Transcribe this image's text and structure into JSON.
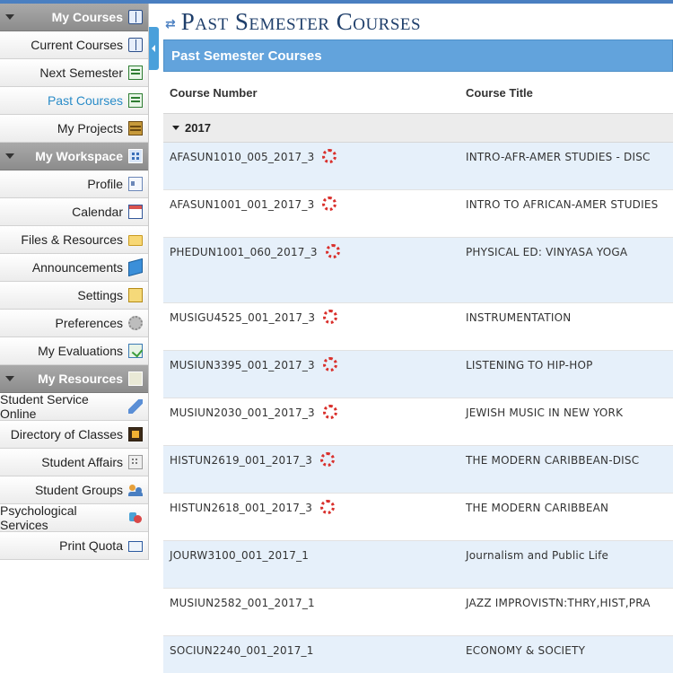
{
  "sidebar": {
    "sections": [
      {
        "title": "My Courses",
        "icon": "course-book-icon",
        "items": [
          {
            "label": "Current Courses",
            "icon": "open-book-icon",
            "active": false
          },
          {
            "label": "Next Semester",
            "icon": "next-semester-icon",
            "active": false
          },
          {
            "label": "Past Courses",
            "icon": "past-courses-icon",
            "active": true
          },
          {
            "label": "My Projects",
            "icon": "projects-icon",
            "active": false
          }
        ]
      },
      {
        "title": "My Workspace",
        "icon": "workspace-grid-icon",
        "items": [
          {
            "label": "Profile",
            "icon": "profile-card-icon"
          },
          {
            "label": "Calendar",
            "icon": "calendar-icon"
          },
          {
            "label": "Files & Resources",
            "icon": "folder-icon"
          },
          {
            "label": "Announcements",
            "icon": "megaphone-icon"
          },
          {
            "label": "Settings",
            "icon": "settings-icon"
          },
          {
            "label": "Preferences",
            "icon": "gear-icon"
          },
          {
            "label": "My Evaluations",
            "icon": "evaluation-icon"
          }
        ]
      },
      {
        "title": "My Resources",
        "icon": "resources-icon",
        "items": [
          {
            "label": "Student Service Online",
            "icon": "pen-icon"
          },
          {
            "label": "Directory of Classes",
            "icon": "directory-icon"
          },
          {
            "label": "Student Affairs",
            "icon": "building-icon"
          },
          {
            "label": "Student Groups",
            "icon": "group-icon"
          },
          {
            "label": "Psychological Services",
            "icon": "psych-services-icon"
          },
          {
            "label": "Print Quota",
            "icon": "print-quota-icon"
          }
        ]
      }
    ]
  },
  "main": {
    "title": "Past Semester Courses",
    "panel_title": "Past Semester Courses",
    "columns": {
      "number": "Course Number",
      "title": "Course Title"
    },
    "group": {
      "year": "2017"
    },
    "rows": [
      {
        "number": "AFASUN1010_005_2017_3",
        "title": "INTRO-AFR-AMER STUDIES - DISC",
        "canvas": true
      },
      {
        "number": "AFASUN1001_001_2017_3",
        "title": "INTRO TO AFRICAN-AMER STUDIES",
        "canvas": true
      },
      {
        "number": "PHEDUN1001_060_2017_3",
        "title": "PHYSICAL ED: VINYASA YOGA",
        "canvas": true
      },
      {
        "number": "MUSIGU4525_001_2017_3",
        "title": "INSTRUMENTATION",
        "canvas": true
      },
      {
        "number": "MUSIUN3395_001_2017_3",
        "title": "LISTENING TO HIP-HOP",
        "canvas": true
      },
      {
        "number": "MUSIUN2030_001_2017_3",
        "title": "JEWISH MUSIC IN NEW YORK",
        "canvas": true
      },
      {
        "number": "HISTUN2619_001_2017_3",
        "title": "THE MODERN CARIBBEAN-DISC",
        "canvas": true
      },
      {
        "number": "HISTUN2618_001_2017_3",
        "title": "THE MODERN CARIBBEAN",
        "canvas": true
      },
      {
        "number": "JOURW3100_001_2017_1",
        "title": "Journalism and Public Life",
        "canvas": false
      },
      {
        "number": "MUSIUN2582_001_2017_1",
        "title": "JAZZ IMPROVISTN:THRY,HIST,PRA",
        "canvas": false
      },
      {
        "number": "SOCIUN2240_001_2017_1",
        "title": "ECONOMY & SOCIETY",
        "canvas": false
      }
    ]
  },
  "colors": {
    "accent": "#62a3dc",
    "title": "#1f3f6b",
    "active_link": "#2a8cc8",
    "canvas_icon": "#d9302c"
  }
}
